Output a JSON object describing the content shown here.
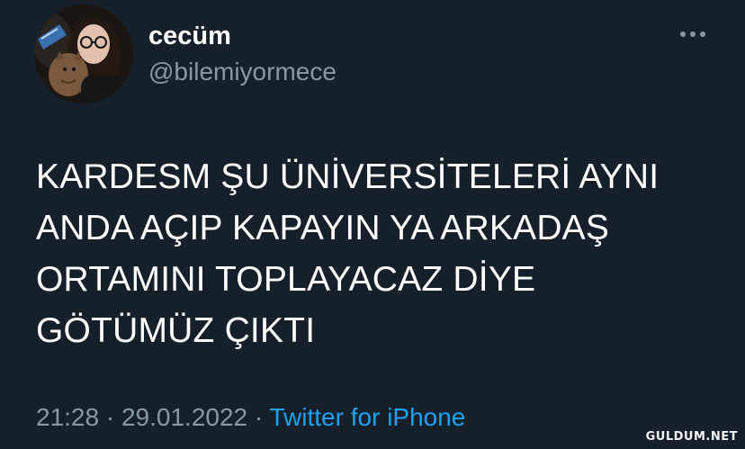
{
  "user": {
    "display_name": "cecüm",
    "username": "@bilemiyormece",
    "avatar_icon": "profile-photo"
  },
  "more_icon": "more-horizontal-icon",
  "tweet": {
    "text": "KARDESM ŞU ÜNİVERSİTELERİ AYNI\nANDA AÇIP KAPAYIN YA ARKADAŞ\nORTAMINI TOPLAYACAZ DİYE\nGÖTÜMÜZ ÇIKTI",
    "time": "21:28",
    "date": "29.01.2022",
    "separator": " · ",
    "source": "Twitter for iPhone"
  },
  "watermark": "GULDUM.NET",
  "colors": {
    "background": "#15202b",
    "primary_text": "#ffffff",
    "secondary_text": "#8899a6",
    "link": "#1da1f2"
  }
}
